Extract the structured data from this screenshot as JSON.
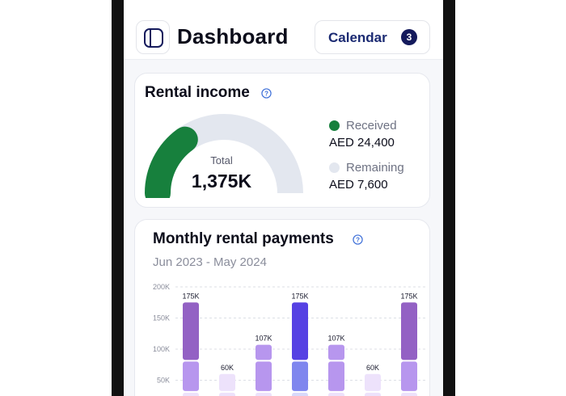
{
  "header": {
    "title": "Dashboard",
    "calendar_label": "Calendar",
    "calendar_count": "3",
    "menu_icon": "sidebar-panel-icon"
  },
  "rental_income": {
    "title": "Rental income",
    "help_icon": "question-circle-icon",
    "gauge": {
      "label": "Total",
      "value": "1,375K",
      "received_fraction": 0.3
    },
    "legend": [
      {
        "name": "Received",
        "amount": "AED 24,400",
        "color": "#17803d"
      },
      {
        "name": "Remaining",
        "amount": "AED 7,600",
        "color": "#e3e7ef"
      }
    ]
  },
  "monthly_payments": {
    "title": "Monthly rental payments",
    "help_icon": "question-circle-icon",
    "date_range": "Jun 2023 - May 2024"
  },
  "chart_data": {
    "type": "bar",
    "stacked": true,
    "title": "Monthly rental payments",
    "subtitle": "Jun 2023 - May 2024",
    "y_ticks": [
      "200K",
      "150K",
      "100K",
      "50K"
    ],
    "ylim": [
      0,
      200
    ],
    "grid": true,
    "value_labels": [
      "175K",
      "60K",
      "107K",
      "175K",
      "107K",
      "60K",
      "175K"
    ],
    "values": [
      175,
      60,
      107,
      175,
      107,
      60,
      175
    ],
    "segment_values": [
      [
        30,
        50,
        95
      ],
      [
        30,
        30,
        0
      ],
      [
        30,
        50,
        27
      ],
      [
        30,
        50,
        95
      ],
      [
        30,
        50,
        27
      ],
      [
        30,
        30,
        0
      ],
      [
        30,
        50,
        95
      ]
    ],
    "colors": [
      [
        "#ede2fb",
        "#b796ee",
        "#9361c4"
      ],
      [
        "#ede2fb",
        "#ede2fb",
        "#ede2fb"
      ],
      [
        "#ede2fb",
        "#b796ee",
        "#b796ee"
      ],
      [
        "#d8d9fb",
        "#7f86ee",
        "#5641e3"
      ],
      [
        "#ede2fb",
        "#b796ee",
        "#b796ee"
      ],
      [
        "#ede2fb",
        "#ede2fb",
        "#ede2fb"
      ],
      [
        "#ede2fb",
        "#b796ee",
        "#9361c4"
      ]
    ]
  }
}
